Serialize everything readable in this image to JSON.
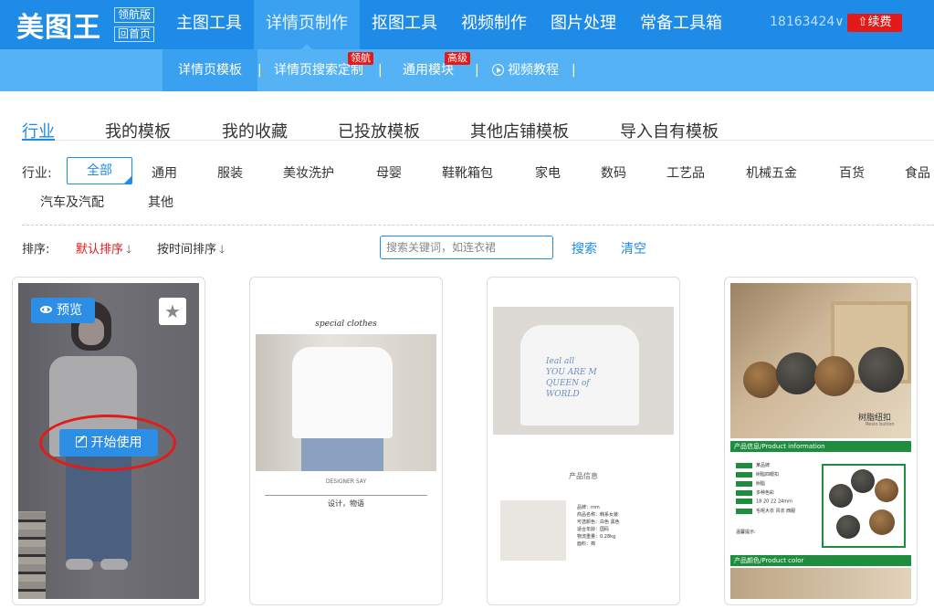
{
  "header": {
    "logo": "美图王",
    "logo_tags": [
      "领航版",
      "回首页"
    ],
    "nav": [
      "主图工具",
      "详情页制作",
      "抠图工具",
      "视频制作",
      "图片处理",
      "常备工具箱"
    ],
    "active_nav": "详情页制作",
    "user": "18163424∨",
    "renew": "续费",
    "brand_color": "#1e8be6"
  },
  "subnav": {
    "items": [
      "详情页模板",
      "详情页搜索定制",
      "通用模块",
      "视频教程"
    ],
    "badges": [
      "领航",
      "高级"
    ],
    "separator": "|"
  },
  "tabs": [
    "行业",
    "我的模板",
    "我的收藏",
    "已投放模板",
    "其他店铺模板",
    "导入自有模板"
  ],
  "industry": {
    "label": "行业:",
    "options": [
      "全部",
      "通用",
      "服装",
      "美妆洗护",
      "母婴",
      "鞋靴箱包",
      "家电",
      "数码",
      "工艺品",
      "机械五金",
      "百货",
      "食品",
      "汽车及汽配",
      "其他"
    ]
  },
  "sort": {
    "label": "排序:",
    "default": "默认排序",
    "by_time": "按时间排序",
    "arrow": "🡓",
    "search_placeholder": "搜索关键词，如连衣裙",
    "search": "搜索",
    "clear": "清空"
  },
  "card1": {
    "preview": "预览",
    "use": "开始使用"
  },
  "card2": {
    "script": "special clothes",
    "title": "设计，物语",
    "subtitle": "DESIGNER SAY"
  },
  "card3": {
    "print": [
      "Ieal all",
      "YOU ARE M",
      "QUEEN of",
      "WORLD"
    ],
    "section": "产品信息",
    "info": [
      "品牌：mm",
      "商品名称：韩系女装",
      "可选颜色：白色  黑色",
      "适合年龄：国码",
      "物流重量：0.28kg",
      "面料：棉"
    ]
  },
  "card4": {
    "brand": "树脂纽扣",
    "brand_en": "Resin button",
    "bar1": "产品信息/Product information",
    "bar2": "产品颜色/Product color",
    "specs": [
      "某品牌",
      "树脂四眼扣",
      "树脂",
      "多种色彩",
      "18 20 22 24mm",
      "毛呢大衣 风衣 西服"
    ],
    "note_title": "温馨提示:"
  }
}
